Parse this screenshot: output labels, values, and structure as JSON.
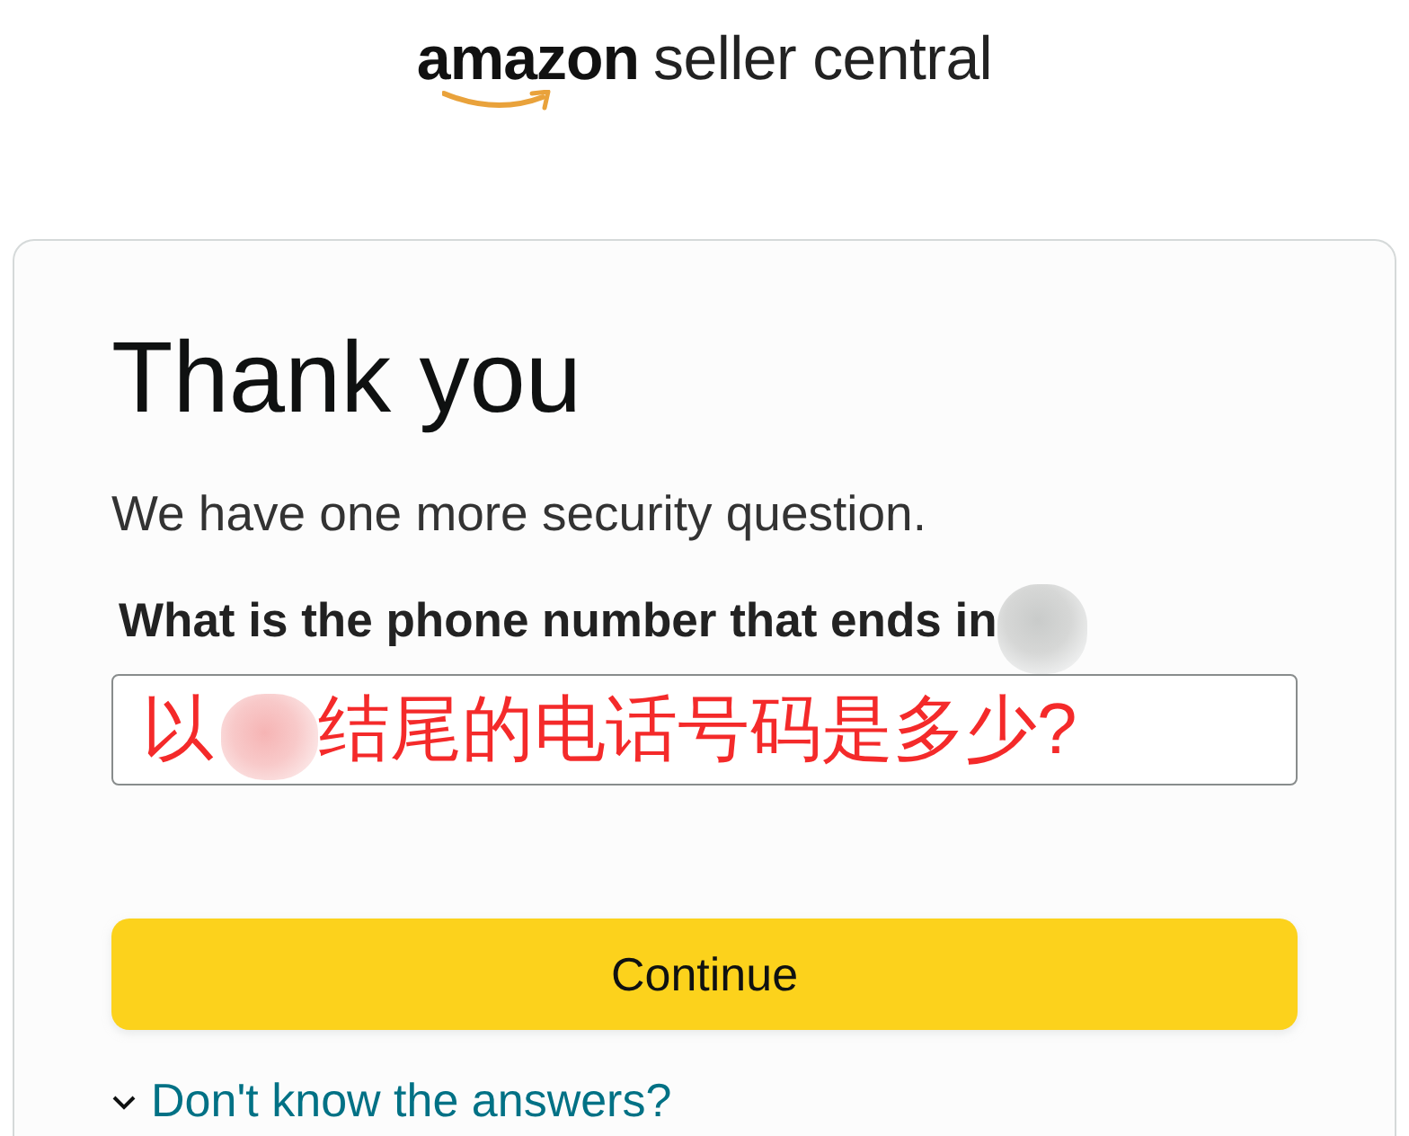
{
  "logo": {
    "brand": "amazon",
    "product": "seller central"
  },
  "card": {
    "title": "Thank you",
    "subtitle": "We have one more security question.",
    "question": {
      "label_parts": [
        {
          "kind": "text",
          "text": "What is the phone number that ends in"
        },
        {
          "kind": "redaction"
        }
      ]
    },
    "answer_field": {
      "value_parts": [
        {
          "kind": "text",
          "text": "以"
        },
        {
          "kind": "redaction"
        },
        {
          "kind": "text",
          "text": "结尾的电话号码是多少?"
        }
      ]
    },
    "continue_button": {
      "label": "Continue"
    },
    "help_link": {
      "label": "Don't know the answers?",
      "expanded": false
    }
  }
}
